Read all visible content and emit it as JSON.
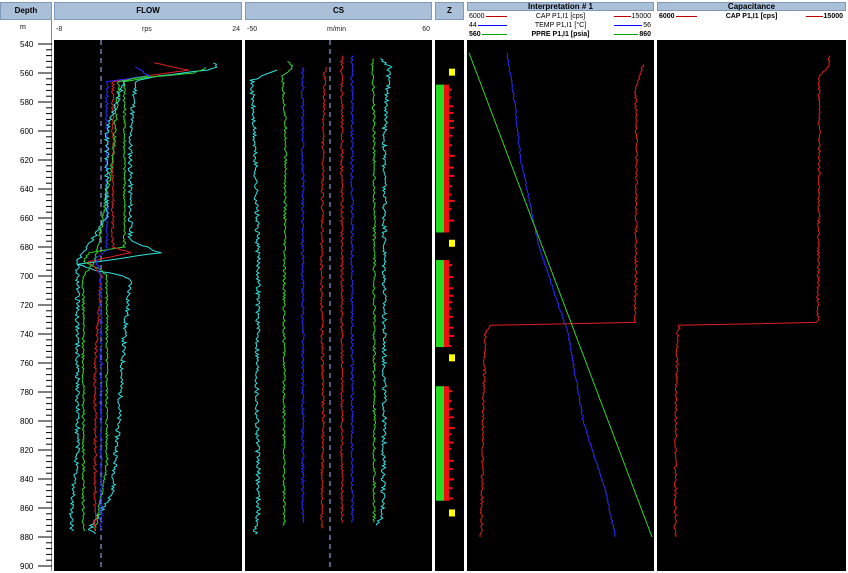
{
  "depth_track": {
    "title": "Depth",
    "unit": "m",
    "ticks": [
      540,
      560,
      580,
      600,
      620,
      640,
      660,
      680,
      700,
      720,
      740,
      760,
      780,
      800,
      820,
      840,
      860,
      880,
      900
    ]
  },
  "tracks": {
    "flow": {
      "title": "FLOW",
      "min": "-8",
      "unit": "rps",
      "max": "24"
    },
    "cs": {
      "title": "CS",
      "min": "-50",
      "unit": "m/min",
      "max": "60"
    },
    "z": {
      "title": "Z"
    },
    "interp": {
      "title": "Interpretation # 1"
    },
    "cap": {
      "title": "Capacitance"
    }
  },
  "legends": {
    "interp": [
      {
        "min": "6000",
        "name": "CAP  P1,I1 [cps]",
        "max": "15000",
        "color": "#c00000",
        "bold": false
      },
      {
        "min": "44",
        "name": "TEMP  P1,I1 [°C]",
        "max": "56",
        "color": "#0000ff",
        "bold": false
      },
      {
        "min": "560",
        "name": "PPRE  P1,I1 [psia]",
        "max": "860",
        "color": "#00aa00",
        "bold": true
      }
    ],
    "cap": [
      {
        "min": "6000",
        "name": "CAP  P1,I1 [cps]",
        "max": "15000",
        "color": "#c00000",
        "bold": true
      }
    ]
  },
  "colors": {
    "cyan": "#35e0e0",
    "green": "#2fd52f",
    "red": "#e02020",
    "blue": "#2a2aff",
    "zone_green": "#22dd22",
    "zone_red": "#ee1111",
    "zone_yellow": "#ffff00"
  },
  "chart_data": [
    {
      "type": "line",
      "title": "FLOW",
      "xlabel": "rps",
      "ylabel": "Depth (m)",
      "xlim": [
        -8,
        24
      ],
      "ylim": [
        900,
        534
      ],
      "reference_line_x": 0,
      "series": [
        {
          "color": "cyan",
          "points": [
            [
              553,
              19
            ],
            [
              556,
              20
            ],
            [
              558,
              18
            ],
            [
              562,
              10
            ],
            [
              565,
              6
            ],
            [
              600,
              5
            ],
            [
              640,
              5
            ],
            [
              676,
              5
            ],
            [
              680,
              8
            ],
            [
              684,
              10
            ],
            [
              688,
              3
            ],
            [
              692,
              -4
            ],
            [
              696,
              -1
            ],
            [
              700,
              4
            ],
            [
              704,
              5
            ],
            [
              740,
              4
            ],
            [
              800,
              3
            ],
            [
              850,
              2
            ],
            [
              875,
              -2
            ],
            [
              878,
              -1
            ]
          ]
        },
        {
          "color": "green",
          "points": [
            [
              556,
              18
            ],
            [
              560,
              16
            ],
            [
              563,
              8
            ],
            [
              566,
              4
            ],
            [
              620,
              4
            ],
            [
              680,
              4
            ],
            [
              684,
              -2
            ],
            [
              690,
              -3
            ],
            [
              696,
              0
            ],
            [
              700,
              1
            ],
            [
              760,
              1
            ],
            [
              830,
              1
            ],
            [
              876,
              -1
            ]
          ]
        },
        {
          "color": "red",
          "points": [
            [
              553,
              9
            ],
            [
              558,
              15
            ],
            [
              562,
              8
            ],
            [
              566,
              2
            ],
            [
              640,
              2
            ],
            [
              680,
              2
            ],
            [
              684,
              5
            ],
            [
              690,
              -2
            ],
            [
              700,
              0
            ],
            [
              760,
              -1
            ],
            [
              860,
              -1
            ],
            [
              876,
              -1
            ]
          ]
        },
        {
          "color": "blue",
          "points": [
            [
              556,
              6
            ],
            [
              562,
              8
            ],
            [
              566,
              1
            ],
            [
              640,
              1
            ],
            [
              682,
              1
            ],
            [
              688,
              -1
            ],
            [
              700,
              0
            ],
            [
              780,
              0
            ],
            [
              876,
              0
            ]
          ]
        },
        {
          "color": "green",
          "points": [
            [
              562,
              8
            ],
            [
              566,
              3
            ],
            [
              620,
              2
            ],
            [
              690,
              -1
            ],
            [
              700,
              -3
            ],
            [
              740,
              -3
            ],
            [
              800,
              -3
            ],
            [
              870,
              -3
            ],
            [
              876,
              -3
            ]
          ]
        },
        {
          "color": "cyan",
          "points": [
            [
              565,
              4
            ],
            [
              600,
              1
            ],
            [
              660,
              1
            ],
            [
              690,
              -4
            ],
            [
              700,
              -4
            ],
            [
              760,
              -4
            ],
            [
              820,
              -4
            ],
            [
              860,
              -5
            ],
            [
              876,
              -5
            ]
          ]
        }
      ]
    },
    {
      "type": "line",
      "title": "CS",
      "xlabel": "m/min",
      "ylabel": "Depth (m)",
      "xlim": [
        -50,
        60
      ],
      "ylim": [
        900,
        534
      ],
      "reference_line_x": 0,
      "series": [
        {
          "color": "cyan",
          "points": [
            [
              558,
              -30
            ],
            [
              565,
              -46
            ],
            [
              620,
              -44
            ],
            [
              700,
              -42
            ],
            [
              780,
              -43
            ],
            [
              860,
              -42
            ],
            [
              878,
              -44
            ]
          ]
        },
        {
          "color": "green",
          "points": [
            [
              552,
              -25
            ],
            [
              556,
              -22
            ],
            [
              562,
              -28
            ],
            [
              600,
              -26
            ],
            [
              700,
              -27
            ],
            [
              800,
              -27
            ],
            [
              872,
              -27
            ]
          ]
        },
        {
          "color": "red",
          "points": [
            [
              556,
              -3
            ],
            [
              600,
              -4
            ],
            [
              700,
              -5
            ],
            [
              800,
              -4
            ],
            [
              860,
              -5
            ],
            [
              874,
              -5
            ]
          ]
        },
        {
          "color": "blue",
          "points": [
            [
              556,
              -16
            ],
            [
              620,
              -16
            ],
            [
              700,
              -16
            ],
            [
              800,
              -16
            ],
            [
              870,
              -16
            ]
          ]
        },
        {
          "color": "red",
          "points": [
            [
              548,
              7
            ],
            [
              600,
              7
            ],
            [
              670,
              7
            ],
            [
              680,
              7
            ],
            [
              720,
              7
            ],
            [
              800,
              7
            ],
            [
              870,
              7
            ]
          ]
        },
        {
          "color": "blue",
          "points": [
            [
              548,
              13
            ],
            [
              600,
              13
            ],
            [
              700,
              13
            ],
            [
              800,
              13
            ],
            [
              870,
              13
            ]
          ]
        },
        {
          "color": "green",
          "points": [
            [
              550,
              25
            ],
            [
              600,
              26
            ],
            [
              700,
              26
            ],
            [
              800,
              26
            ],
            [
              870,
              26
            ]
          ]
        },
        {
          "color": "cyan",
          "points": [
            [
              550,
              30
            ],
            [
              556,
              35
            ],
            [
              600,
              32
            ],
            [
              700,
              32
            ],
            [
              800,
              32
            ],
            [
              866,
              31
            ],
            [
              872,
              27
            ]
          ]
        }
      ]
    },
    {
      "type": "table",
      "title": "Z",
      "ylabel": "Depth (m)",
      "zones": [
        {
          "top": 557,
          "bottom": 559,
          "kind": "yellow"
        },
        {
          "top": 568,
          "bottom": 670,
          "kind": "green-red"
        },
        {
          "top": 675,
          "bottom": 677,
          "kind": "yellow"
        },
        {
          "top": 689,
          "bottom": 749,
          "kind": "green-red"
        },
        {
          "top": 754,
          "bottom": 756,
          "kind": "yellow"
        },
        {
          "top": 776,
          "bottom": 855,
          "kind": "green-red"
        },
        {
          "top": 861,
          "bottom": 863,
          "kind": "yellow"
        }
      ]
    },
    {
      "type": "line",
      "title": "Interpretation # 1",
      "ylabel": "Depth (m)",
      "ylim": [
        900,
        534
      ],
      "series": [
        {
          "name": "CAP  P1,I1 [cps]",
          "color": "red",
          "x_range": [
            6000,
            15000
          ],
          "points": [
            [
              554,
              14600
            ],
            [
              560,
              14400
            ],
            [
              566,
              14300
            ],
            [
              572,
              14200
            ],
            [
              620,
              14250
            ],
            [
              700,
              14200
            ],
            [
              732,
              14150
            ],
            [
              734,
              7000
            ],
            [
              740,
              6800
            ],
            [
              800,
              6700
            ],
            [
              880,
              6600
            ]
          ]
        },
        {
          "name": "TEMP  P1,I1 [°C]",
          "color": "blue",
          "x_range": [
            44,
            56
          ],
          "points": [
            [
              546,
              46.5
            ],
            [
              580,
              47.0
            ],
            [
              620,
              47.4
            ],
            [
              680,
              48.6
            ],
            [
              740,
              50.5
            ],
            [
              800,
              51.5
            ],
            [
              850,
              53.0
            ],
            [
              880,
              53.6
            ]
          ]
        },
        {
          "name": "PPRE  P1,I1 [psia]",
          "color": "green",
          "x_range": [
            560,
            860
          ],
          "points": [
            [
              546,
              560
            ],
            [
              880,
              860
            ]
          ]
        }
      ]
    },
    {
      "type": "line",
      "title": "Capacitance",
      "ylabel": "Depth (m)",
      "ylim": [
        900,
        534
      ],
      "series": [
        {
          "name": "CAP  P1,I1 [cps]",
          "color": "red",
          "x_range": [
            6000,
            15000
          ],
          "points": [
            [
              548,
              14300
            ],
            [
              556,
              14200
            ],
            [
              562,
              13800
            ],
            [
              620,
              13800
            ],
            [
              700,
              13750
            ],
            [
              732,
              13700
            ],
            [
              734,
              7000
            ],
            [
              740,
              6900
            ],
            [
              820,
              6800
            ],
            [
              880,
              6800
            ]
          ]
        }
      ]
    }
  ]
}
